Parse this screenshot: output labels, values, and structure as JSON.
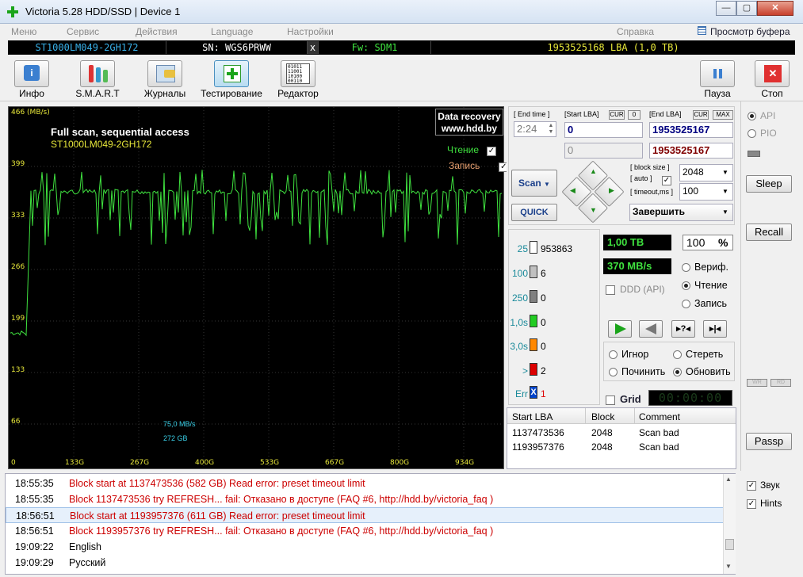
{
  "window": {
    "title": "Victoria 5.28 HDD/SSD | Device 1",
    "min": "—",
    "max": "▢",
    "close": "✕"
  },
  "menu": [
    "Меню",
    "Сервис",
    "Действия",
    "Language",
    "Настройки",
    "Справка"
  ],
  "buffer_view": "Просмотр буфера",
  "info": {
    "model": "ST1000LM049-2GH172",
    "serial": "SN: WGS6PRWW",
    "x": "x",
    "fw": "Fw: SDM1",
    "lba": "1953525168 LBA (1,0 TB)"
  },
  "toolbar": [
    {
      "label": "Инфо",
      "icon": "info-icon"
    },
    {
      "label": "S.M.A.R.T",
      "icon": "smart-icon"
    },
    {
      "label": "Журналы",
      "icon": "journal-icon"
    },
    {
      "label": "Тестирование",
      "icon": "test-icon"
    },
    {
      "label": "Редактор",
      "icon": "editor-icon"
    },
    {
      "label": "Пауза",
      "icon": "pause-icon"
    },
    {
      "label": "Стоп",
      "icon": "stop-icon"
    }
  ],
  "graph": {
    "unit": "466 (MB/s)",
    "heading": "Full scan, sequential access",
    "model": "ST1000LM049-2GH172",
    "brand1": "Data recovery",
    "brand2": "www.hdd.by",
    "read_label": "Чтение",
    "write_label": "Запись",
    "speed": "75,0 MB/s",
    "pos": "272 GB",
    "yticks": [
      "399",
      "333",
      "266",
      "199",
      "133",
      "66"
    ],
    "xticks": [
      "0",
      "133G",
      "267G",
      "400G",
      "533G",
      "667G",
      "800G",
      "934G"
    ],
    "colors": {
      "line": "#3fe23f",
      "tick": "#e8e83a",
      "text": "#ffffff"
    }
  },
  "controls": {
    "end_time_label": "End time",
    "start_lba_label": "Start LBA",
    "cur": "CUR",
    "zero": "0",
    "end_lba_label": "End LBA",
    "max": "MAX",
    "end_time": "2:24",
    "start_lba": "0",
    "end_lba": "1953525167",
    "start_lba2": "0",
    "end_lba2": "1953525167",
    "scan": "Scan",
    "quick": "QUICK",
    "block_size_label": "block size",
    "auto_label": "auto",
    "timeout_label": "timeout,ms",
    "block_size": "2048",
    "timeout": "100",
    "finish": "Завершить"
  },
  "blocks": [
    {
      "num": "25",
      "val": "953863",
      "color": "#ffffff"
    },
    {
      "num": "100",
      "val": "6",
      "color": "#c0c0c0"
    },
    {
      "num": "250",
      "val": "0",
      "color": "#808080"
    },
    {
      "num": "1,0s",
      "val": "0",
      "color": "#22cc22"
    },
    {
      "num": "3,0s",
      "val": "0",
      "color": "#ff8800"
    },
    {
      "num": ">",
      "val": "2",
      "color": "#dd0000"
    },
    {
      "num": "Err",
      "val": "1",
      "color": "#0044cc"
    }
  ],
  "err_mark": "X",
  "status": {
    "size": "1,00 TB",
    "percent": "100",
    "pct": "%",
    "speed": "370 MB/s",
    "ddd": "DDD (API)",
    "verify": "Вериф.",
    "read": "Чтение",
    "write": "Запись"
  },
  "actions": {
    "ignore": "Игнор",
    "erase": "Стереть",
    "repair": "Починить",
    "refresh": "Обновить",
    "grid": "Grid",
    "timer": "00:00:00"
  },
  "table": {
    "headers": [
      "Start LBA",
      "Block",
      "Comment"
    ],
    "rows": [
      [
        "1137473536",
        "2048",
        "Scan bad"
      ],
      [
        "1193957376",
        "2048",
        "Scan bad"
      ]
    ]
  },
  "right": {
    "api": "API",
    "pio": "PIO",
    "sleep": "Sleep",
    "recall": "Recall",
    "passp": "Passp",
    "wr": "WR",
    "rd": "RD",
    "sound": "Звук",
    "hints": "Hints"
  },
  "log": [
    {
      "time": "18:55:35",
      "msg": "Block start at 1137473536 (582 GB) Read error: preset timeout limit",
      "color": "#cc0000"
    },
    {
      "time": "18:55:35",
      "msg": "Block 1137473536 try REFRESH... fail: Отказано в доступе (FAQ #6, http://hdd.by/victoria_faq )",
      "color": "#cc0000"
    },
    {
      "time": "18:56:51",
      "msg": "Block start at 1193957376 (611 GB) Read error: preset timeout limit",
      "color": "#cc0000"
    },
    {
      "time": "18:56:51",
      "msg": "Block 1193957376 try REFRESH... fail: Отказано в доступе (FAQ #6, http://hdd.by/victoria_faq )",
      "color": "#cc0000"
    },
    {
      "time": "19:09:22",
      "msg": "English",
      "color": "#000000"
    },
    {
      "time": "19:09:29",
      "msg": "Русский",
      "color": "#000000"
    }
  ]
}
